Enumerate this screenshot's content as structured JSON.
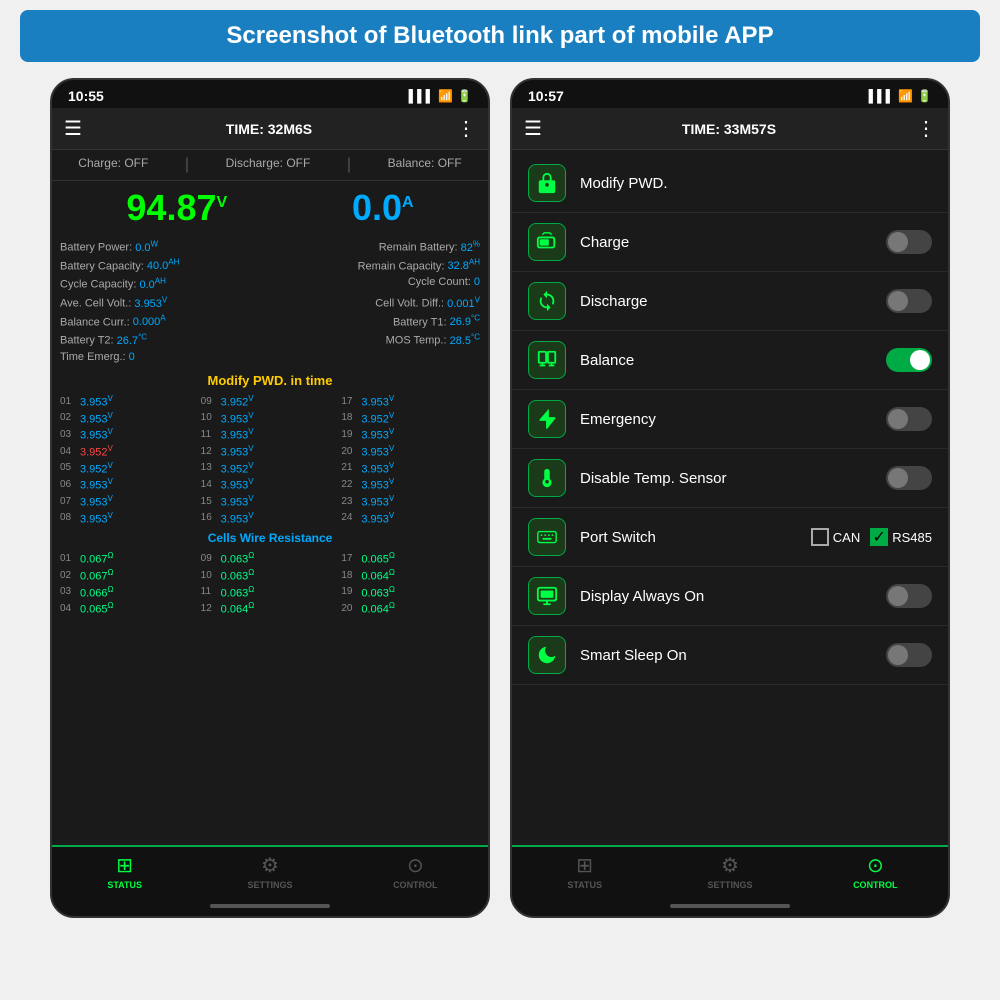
{
  "page": {
    "background": "#f0f0f0",
    "banner": {
      "text": "Screenshot of Bluetooth link part of mobile APP",
      "bg_color": "#1a7fc1"
    }
  },
  "left_phone": {
    "status_bar": {
      "time": "10:55"
    },
    "header": {
      "title": "TIME: 32M6S"
    },
    "charge_status": "OFF",
    "discharge_status": "OFF",
    "balance_status": "OFF",
    "voltage": "94.87",
    "voltage_unit": "V",
    "ampere": "0.0",
    "ampere_unit": "A",
    "battery_power": "0.0",
    "battery_power_unit": "W",
    "remain_battery": "82",
    "remain_battery_unit": "%",
    "battery_capacity": "40.0",
    "battery_capacity_unit": "AH",
    "remain_capacity": "32.8",
    "remain_capacity_unit": "AH",
    "cycle_capacity": "0.0",
    "cycle_capacity_unit": "AH",
    "cycle_count": "0",
    "ave_cell_volt": "3.953",
    "ave_cell_volt_unit": "V",
    "cell_volt_diff": "0.001",
    "cell_volt_diff_unit": "V",
    "balance_curr": "0.000",
    "balance_curr_unit": "A",
    "battery_t1": "26.9",
    "battery_t1_unit": "°C",
    "battery_t2": "26.7",
    "battery_t2_unit": "°C",
    "mos_temp": "28.5",
    "mos_temp_unit": "°C",
    "time_emerg": "0",
    "section_title": "Modify PWD. in time",
    "cells": [
      {
        "num": "01",
        "val": "3.953",
        "unit": "V",
        "red": false
      },
      {
        "num": "09",
        "val": "3.952",
        "unit": "V",
        "red": false
      },
      {
        "num": "17",
        "val": "3.953",
        "unit": "V",
        "red": false
      },
      {
        "num": "02",
        "val": "3.953",
        "unit": "V",
        "red": false
      },
      {
        "num": "10",
        "val": "3.953",
        "unit": "V",
        "red": false
      },
      {
        "num": "18",
        "val": "3.952",
        "unit": "V",
        "red": false
      },
      {
        "num": "03",
        "val": "3.953",
        "unit": "V",
        "red": false
      },
      {
        "num": "11",
        "val": "3.953",
        "unit": "V",
        "red": false
      },
      {
        "num": "19",
        "val": "3.953",
        "unit": "V",
        "red": false
      },
      {
        "num": "04",
        "val": "3.952",
        "unit": "V",
        "red": true
      },
      {
        "num": "12",
        "val": "3.953",
        "unit": "V",
        "red": false
      },
      {
        "num": "20",
        "val": "3.953",
        "unit": "V",
        "red": false
      },
      {
        "num": "05",
        "val": "3.952",
        "unit": "V",
        "red": false
      },
      {
        "num": "13",
        "val": "3.952",
        "unit": "V",
        "red": false
      },
      {
        "num": "21",
        "val": "3.953",
        "unit": "V",
        "red": false
      },
      {
        "num": "06",
        "val": "3.953",
        "unit": "V",
        "red": false
      },
      {
        "num": "14",
        "val": "3.953",
        "unit": "V",
        "red": false
      },
      {
        "num": "22",
        "val": "3.953",
        "unit": "V",
        "red": false
      },
      {
        "num": "07",
        "val": "3.953",
        "unit": "V",
        "red": false
      },
      {
        "num": "15",
        "val": "3.953",
        "unit": "V",
        "red": false
      },
      {
        "num": "23",
        "val": "3.953",
        "unit": "V",
        "red": false
      },
      {
        "num": "08",
        "val": "3.953",
        "unit": "V",
        "red": false
      },
      {
        "num": "16",
        "val": "3.953",
        "unit": "V",
        "red": false
      },
      {
        "num": "24",
        "val": "3.953",
        "unit": "V",
        "red": false
      }
    ],
    "resistance_title": "Cells Wire Resistance",
    "resistances": [
      {
        "num": "01",
        "val": "0.067",
        "unit": "Ω"
      },
      {
        "num": "09",
        "val": "0.063",
        "unit": "Ω"
      },
      {
        "num": "17",
        "val": "0.065",
        "unit": "Ω"
      },
      {
        "num": "02",
        "val": "0.067",
        "unit": "Ω"
      },
      {
        "num": "10",
        "val": "0.063",
        "unit": "Ω"
      },
      {
        "num": "18",
        "val": "0.064",
        "unit": "Ω"
      },
      {
        "num": "03",
        "val": "0.066",
        "unit": "Ω"
      },
      {
        "num": "11",
        "val": "0.063",
        "unit": "Ω"
      },
      {
        "num": "19",
        "val": "0.063",
        "unit": "Ω"
      },
      {
        "num": "04",
        "val": "0.065",
        "unit": "Ω"
      },
      {
        "num": "12",
        "val": "0.064",
        "unit": "Ω"
      },
      {
        "num": "20",
        "val": "0.064",
        "unit": "Ω"
      }
    ],
    "nav": {
      "status_label": "STATUS",
      "settings_label": "SETTINGS",
      "control_label": "CONTROL"
    }
  },
  "right_phone": {
    "status_bar": {
      "time": "10:57"
    },
    "header": {
      "title": "TIME: 33M57S"
    },
    "controls": [
      {
        "icon": "🔒",
        "label": "Modify PWD.",
        "type": "navigate",
        "toggle": false,
        "active": false
      },
      {
        "icon": "🔋",
        "label": "Charge",
        "type": "toggle",
        "toggle": true,
        "active": false
      },
      {
        "icon": "♻️",
        "label": "Discharge",
        "type": "toggle",
        "toggle": true,
        "active": false
      },
      {
        "icon": "🔋",
        "label": "Balance",
        "type": "toggle",
        "toggle": true,
        "active": true
      },
      {
        "icon": "⚡",
        "label": "Emergency",
        "type": "toggle",
        "toggle": true,
        "active": false
      },
      {
        "icon": "🌡️",
        "label": "Disable Temp. Sensor",
        "type": "toggle",
        "toggle": true,
        "active": false
      },
      {
        "icon": "⌨️",
        "label": "Port Switch",
        "type": "port",
        "toggle": false,
        "active": false,
        "can": false,
        "rs485": true
      },
      {
        "icon": "🖥️",
        "label": "Display Always On",
        "type": "toggle",
        "toggle": true,
        "active": false
      },
      {
        "icon": "🌙",
        "label": "Smart Sleep On",
        "type": "toggle",
        "toggle": true,
        "active": false
      }
    ],
    "nav": {
      "status_label": "STATUS",
      "settings_label": "SETTINGS",
      "control_label": "CONTROL"
    }
  }
}
